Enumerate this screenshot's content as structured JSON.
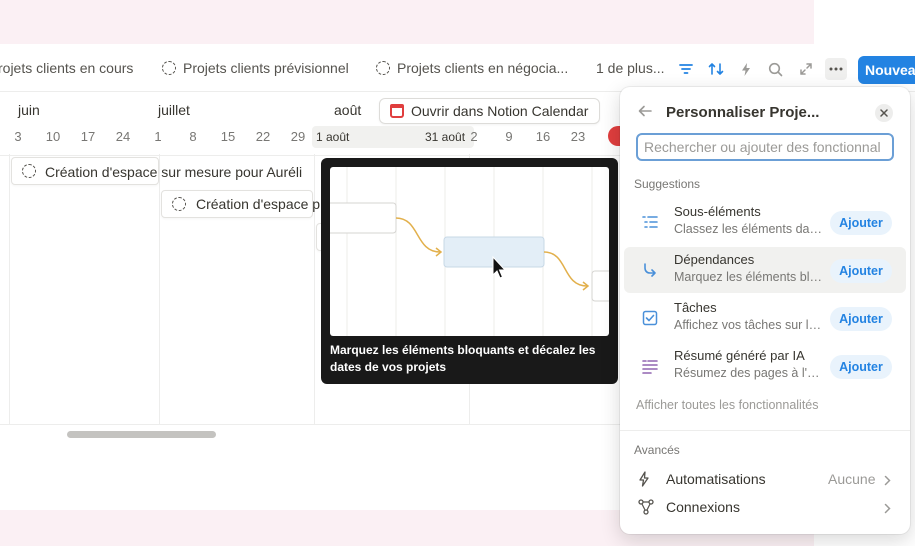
{
  "views": {
    "tabs": [
      "rojets clients en cours",
      "Projets clients prévisionnel",
      "Projets clients en négocia..."
    ],
    "more": "1 de plus...",
    "new_button": "Nouvea"
  },
  "timeline": {
    "months": [
      "juin",
      "juillet",
      "août"
    ],
    "days": [
      "3",
      "10",
      "17",
      "24",
      "1",
      "8",
      "15",
      "22",
      "29",
      "2",
      "9",
      "16",
      "23"
    ],
    "range_start": "1 août",
    "range_end": "31 août",
    "open_calendar": "Ouvrir dans Notion Calendar",
    "items": [
      "Création d'espace sur mesure pour Auréli",
      "Création d'espace p"
    ]
  },
  "tooltip": {
    "text": "Marquez les éléments bloquants et décalez les dates de vos projets"
  },
  "panel": {
    "title": "Personnaliser Proje...",
    "search_placeholder": "Rechercher ou ajouter des fonctionnal",
    "suggestions_label": "Suggestions",
    "features": [
      {
        "name": "Sous-éléments",
        "desc": "Classez les éléments dans des...",
        "action": "Ajouter",
        "icon": "subitems-icon"
      },
      {
        "name": "Dépendances",
        "desc": "Marquez les éléments bloquants",
        "action": "Ajouter",
        "icon": "dependency-arrow-icon"
      },
      {
        "name": "Tâches",
        "desc": "Affichez vos tâches sur la ligne",
        "action": "Ajouter",
        "icon": "checkbox-icon"
      },
      {
        "name": "Résumé généré par IA",
        "desc": "Résumez des pages à l'aide de l'IA",
        "action": "Ajouter",
        "icon": "ai-summary-icon"
      }
    ],
    "show_all": "Afficher toutes les fonctionnalités",
    "advanced_label": "Avancés",
    "advanced": [
      {
        "name": "Automatisations",
        "value": "Aucune"
      },
      {
        "name": "Connexions",
        "value": ""
      }
    ]
  }
}
